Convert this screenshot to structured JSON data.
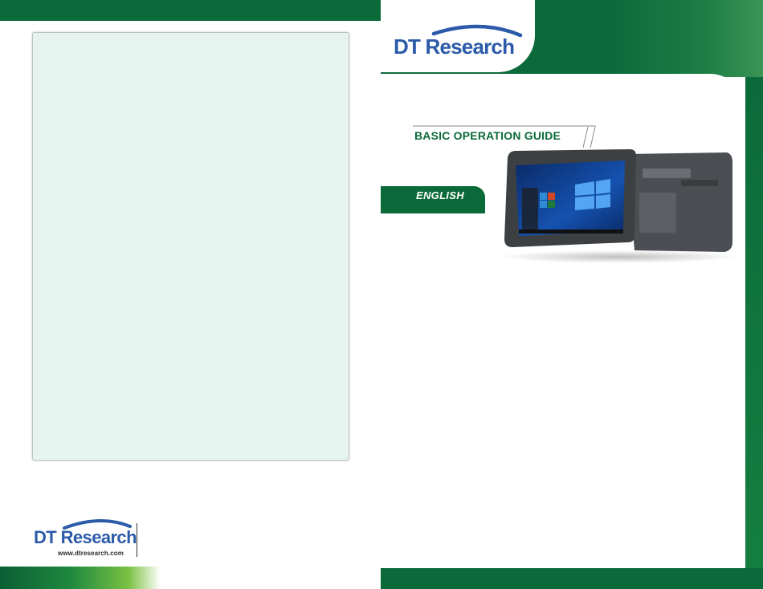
{
  "brand": {
    "name": "DT Research",
    "website": "www.dtresearch.com"
  },
  "cover": {
    "guide_title": "BASIC OPERATION GUIDE",
    "language": "ENGLISH"
  },
  "colors": {
    "brand_green": "#0b6a3a",
    "logo_blue": "#2b5aa8",
    "panel_bg": "#e6f4ef"
  },
  "icons": [
    "dt-research-logo-swoosh",
    "tablet-device-image"
  ]
}
